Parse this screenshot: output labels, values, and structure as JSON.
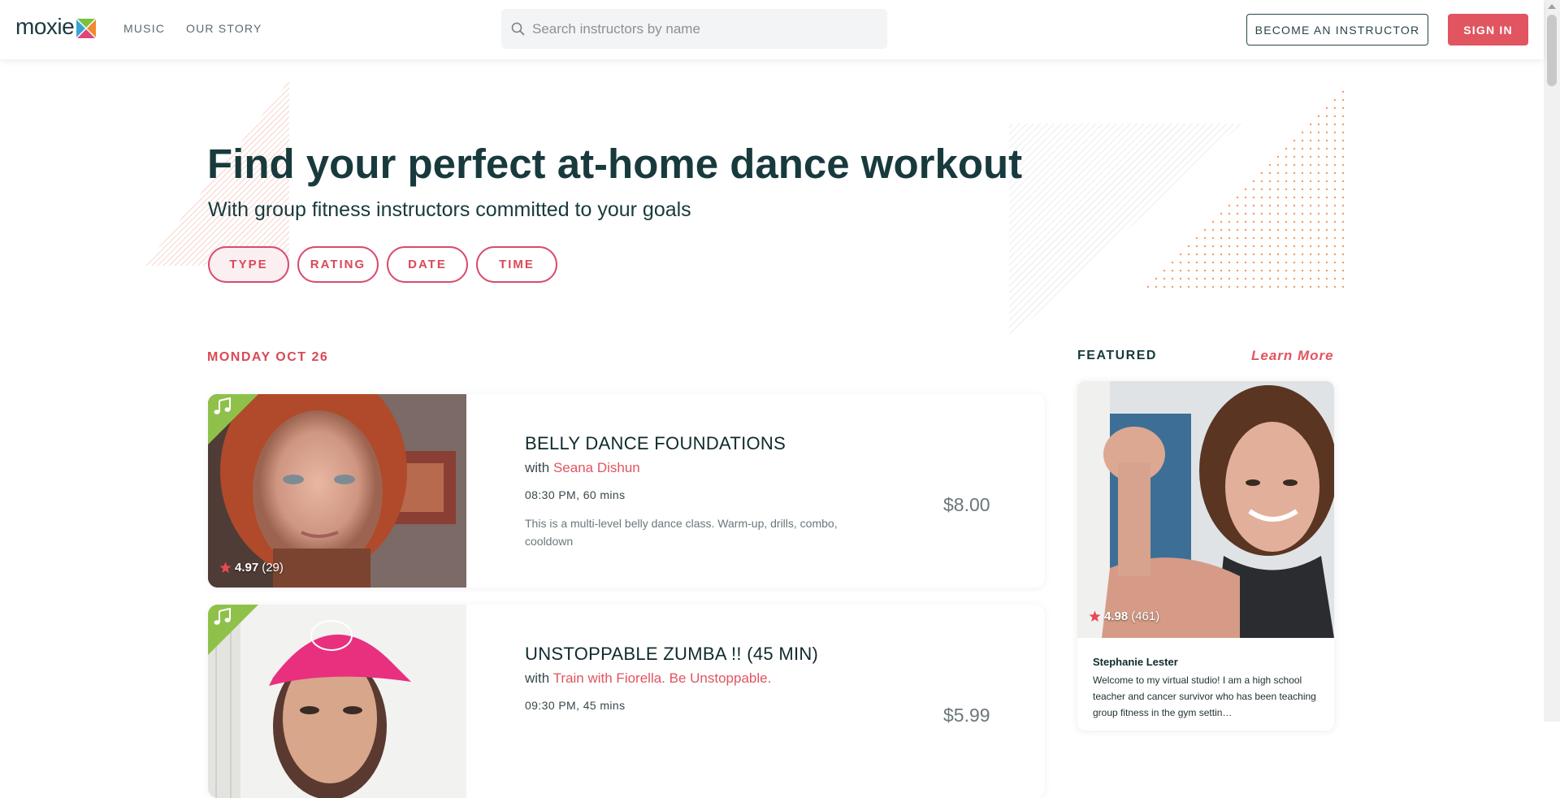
{
  "nav": {
    "logo_text": "moxie",
    "links": [
      "MUSIC",
      "OUR STORY"
    ],
    "search_placeholder": "Search instructors by name",
    "become_instructor": "BECOME AN INSTRUCTOR",
    "sign_in": "SIGN IN"
  },
  "hero": {
    "title": "Find your perfect at-home dance workout",
    "subtitle": "With group fitness instructors committed to your goals",
    "filters": [
      "TYPE",
      "RATING",
      "DATE",
      "TIME"
    ]
  },
  "schedule": {
    "date_heading": "MONDAY OCT 26",
    "classes": [
      {
        "title": "BELLY DANCE FOUNDATIONS",
        "with": "with",
        "instructor": "Seana Dishun",
        "time": "08:30 PM, 60 mins",
        "description": "This is a multi-level belly dance class. Warm-up, drills, combo, cooldown",
        "price": "$8.00",
        "rating": "4.97",
        "rating_count": "(29)"
      },
      {
        "title": "UNSTOPPABLE ZUMBA !! (45 MIN)",
        "with": "with",
        "instructor": "Train with Fiorella. Be Unstoppable.",
        "time": "09:30 PM, 45 mins",
        "description": "",
        "price": "$5.99",
        "rating": "",
        "rating_count": ""
      }
    ]
  },
  "featured": {
    "label": "FEATURED",
    "learn_more": "Learn More",
    "name": "Stephanie Lester",
    "bio": "Welcome to my virtual studio! I am a high school teacher and cancer survivor who has been teaching group fitness in the gym settin…",
    "rating": "4.98",
    "rating_count": "(461)"
  },
  "colors": {
    "accent": "#e05560",
    "dark": "#183a3d",
    "music_badge": "#8fc14a",
    "pill_border": "#d94c6e"
  }
}
